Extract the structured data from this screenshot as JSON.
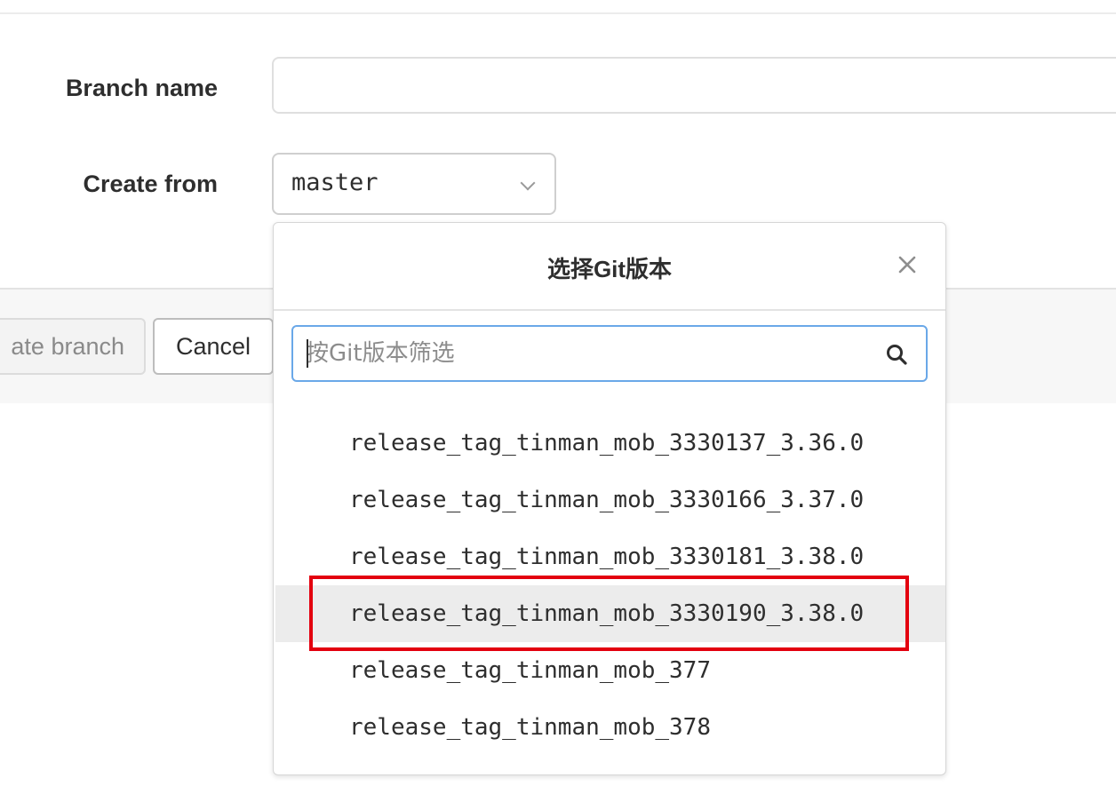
{
  "form": {
    "branch_name_label": "Branch name",
    "branch_name_value": "",
    "create_from_label": "Create from",
    "create_from_value": "master"
  },
  "actions": {
    "create_button_label": "Create branch",
    "create_button_visible_text": "ate branch",
    "cancel_button_label": "Cancel"
  },
  "dropdown": {
    "title": "选择Git版本",
    "search_placeholder": "按Git版本筛选",
    "items": [
      "release_tag_tinman_mob_3330137_3.36.0",
      "release_tag_tinman_mob_3330166_3.37.0",
      "release_tag_tinman_mob_3330181_3.38.0",
      "release_tag_tinman_mob_3330190_3.38.0",
      "release_tag_tinman_mob_377",
      "release_tag_tinman_mob_378"
    ],
    "highlighted_item": "release_tag_tinman_mob_3330190_3.38.0"
  },
  "colors": {
    "annotation_box": "#e3000f",
    "search_focus_border": "#6aa8e8",
    "active_item_bg": "#ececec"
  },
  "icons": {
    "dropdown_chevron": "chevron-down-icon",
    "close": "close-icon",
    "search": "search-icon"
  }
}
